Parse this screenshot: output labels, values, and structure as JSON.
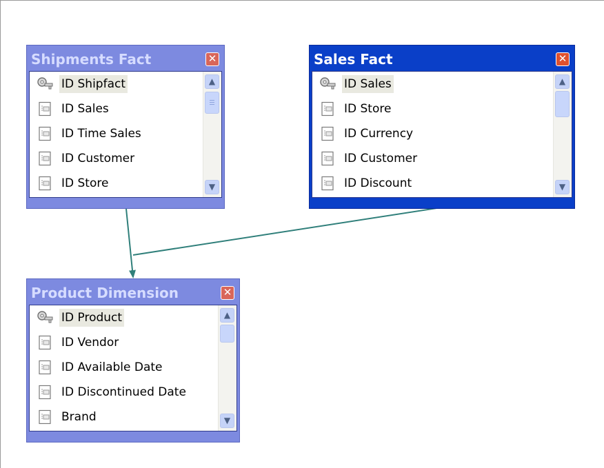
{
  "tables": [
    {
      "id": "shipments",
      "title": "Shipments Fact",
      "active": false,
      "close_glyph": "✕",
      "fields": [
        {
          "name": "ID Shipfact",
          "key": true
        },
        {
          "name": "ID Sales",
          "key": false
        },
        {
          "name": "ID Time Sales",
          "key": false
        },
        {
          "name": "ID Customer",
          "key": false
        },
        {
          "name": "ID Store",
          "key": false
        }
      ]
    },
    {
      "id": "sales",
      "title": "Sales Fact",
      "active": true,
      "close_glyph": "✕",
      "fields": [
        {
          "name": "ID Sales",
          "key": true
        },
        {
          "name": "ID Store",
          "key": false
        },
        {
          "name": "ID Currency",
          "key": false
        },
        {
          "name": "ID Customer",
          "key": false
        },
        {
          "name": "ID Discount",
          "key": false
        }
      ]
    },
    {
      "id": "product",
      "title": "Product Dimension",
      "active": false,
      "close_glyph": "✕",
      "fields": [
        {
          "name": "ID Product",
          "key": true
        },
        {
          "name": "ID Vendor",
          "key": false
        },
        {
          "name": "ID Available Date",
          "key": false
        },
        {
          "name": "ID Discontinued Date",
          "key": false
        },
        {
          "name": "Brand",
          "key": false
        }
      ]
    }
  ],
  "relationships": [
    {
      "from": "shipments",
      "to": "product"
    },
    {
      "from": "sales",
      "to": "product"
    }
  ],
  "colors": {
    "window_inactive": "#7d8ae0",
    "window_active": "#0a3fc8",
    "connector": "#2f7f7a"
  },
  "icons": {
    "key_field": "key-icon",
    "field": "field-icon",
    "scroll_up": "▲",
    "scroll_down": "▼"
  }
}
